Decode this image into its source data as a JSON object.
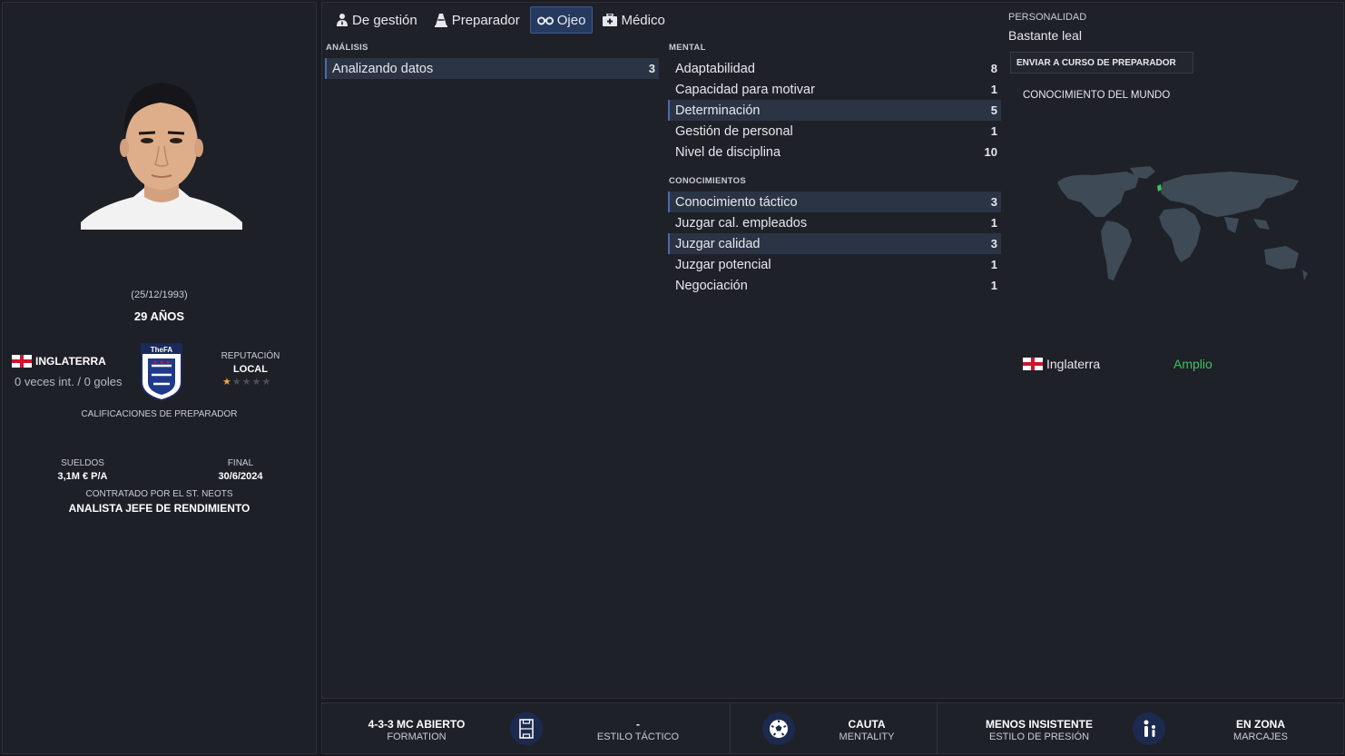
{
  "profile": {
    "dob": "(25/12/1993)",
    "age": "29 AÑOS",
    "nation": "INGLATERRA",
    "caps": "0 veces int. / 0 goles",
    "crest_text": "TheFA",
    "reputation_label": "REPUTACIÓN",
    "reputation_value": "LOCAL",
    "reputation_stars": 0.5,
    "reputation_stars_max": 5,
    "coach_ratings": "CALIFICACIONES DE PREPARADOR",
    "wage_label": "SUELDOS",
    "wage_value": "3,1M € P/A",
    "end_label": "FINAL",
    "end_value": "30/6/2024",
    "contracted": "CONTRATADO POR EL ST. NEOTS",
    "role": "ANALISTA JEFE DE RENDIMIENTO"
  },
  "tabs": [
    {
      "label": "De gestión",
      "icon": "manager-icon",
      "active": false
    },
    {
      "label": "Preparador",
      "icon": "coach-cone-icon",
      "active": false
    },
    {
      "label": "Ojeo",
      "icon": "binoculars-icon",
      "active": true
    },
    {
      "label": "Médico",
      "icon": "medical-kit-icon",
      "active": false
    }
  ],
  "analysis": {
    "title": "ANÁLISIS",
    "rows": [
      {
        "label": "Analizando datos",
        "value": "3",
        "highlight": true
      }
    ]
  },
  "mental": {
    "title": "MENTAL",
    "rows": [
      {
        "label": "Adaptabilidad",
        "value": "8",
        "highlight": false
      },
      {
        "label": "Capacidad para motivar",
        "value": "1",
        "highlight": false
      },
      {
        "label": "Determinación",
        "value": "5",
        "highlight": true
      },
      {
        "label": "Gestión de personal",
        "value": "1",
        "highlight": false
      },
      {
        "label": "Nivel de disciplina",
        "value": "10",
        "highlight": false
      }
    ]
  },
  "knowledge": {
    "title": "CONOCIMIENTOS",
    "rows": [
      {
        "label": "Conocimiento táctico",
        "value": "3",
        "highlight": true
      },
      {
        "label": "Juzgar cal. empleados",
        "value": "1",
        "highlight": false
      },
      {
        "label": "Juzgar calidad",
        "value": "3",
        "highlight": true
      },
      {
        "label": "Juzgar potencial",
        "value": "1",
        "highlight": false
      },
      {
        "label": "Negociación",
        "value": "1",
        "highlight": false
      }
    ]
  },
  "personality": {
    "label": "PERSONALIDAD",
    "value": "Bastante leal",
    "send_button": "ENVIAR A CURSO DE PREPARADOR"
  },
  "world_knowledge": {
    "title": "CONOCIMIENTO DEL MUNDO",
    "nation": "Inglaterra",
    "level": "Amplio"
  },
  "bottom": {
    "formation_value": "4-3-3 MC ABIERTO",
    "formation_label": "FORMATION",
    "style_value": "-",
    "style_label": "ESTILO TÁCTICO",
    "mentality_value": "CAUTA",
    "mentality_label": "MENTALITY",
    "press_value": "MENOS INSISTENTE",
    "press_label": "ESTILO DE PRESIÓN",
    "marking_value": "EN ZONA",
    "marking_label": "MARCAJES"
  },
  "colors": {
    "accent": "#3b5a8f",
    "highlight_row": "#2b3445",
    "level_green": "#3cc35f",
    "star_gold": "#e8a53a"
  }
}
